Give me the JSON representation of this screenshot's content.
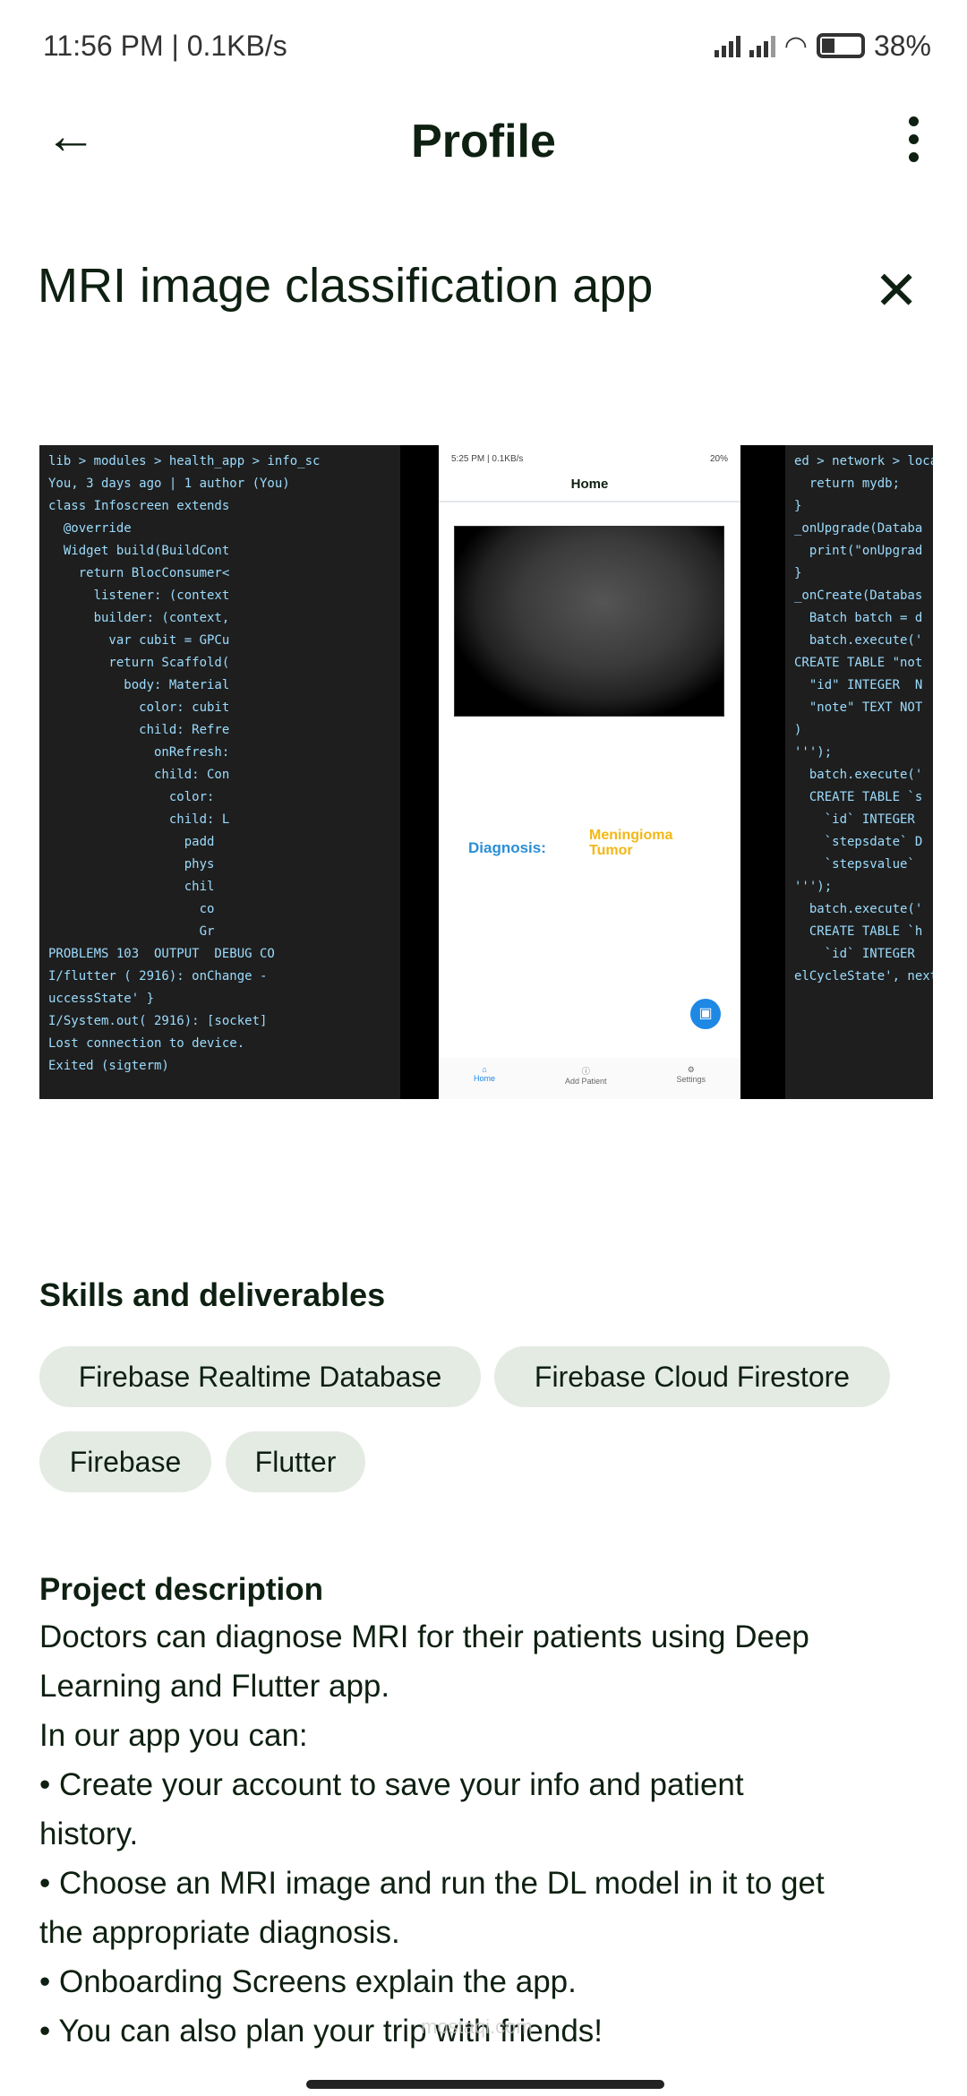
{
  "status_bar": {
    "time": "11:56 PM | 0.1KB/s",
    "battery": "38%"
  },
  "app_bar": {
    "title": "Profile"
  },
  "project": {
    "title": "MRI image classification app"
  },
  "gallery": {
    "left_code": [
      "lib > modules > health_app > info_sc",
      "You, 3 days ago | 1 author (You)",
      "class Infoscreen extends",
      "  @override",
      "  Widget build(BuildCont",
      "    return BlocConsumer<",
      "      listener: (context",
      "      builder: (context,",
      "        var cubit = GPCu",
      "        return Scaffold(",
      "          body: Material",
      "            color: cubit",
      "            child: Refre",
      "              onRefresh:",
      "              child: Con",
      "                color:",
      "                child: L",
      "                  padd",
      "                  phys",
      "                  chil",
      "                    co",
      "                    Gr",
      "",
      "",
      "PROBLEMS 103  OUTPUT  DEBUG CO",
      "I/flutter ( 2916): onChange -",
      "uccessState' }",
      "I/System.out( 2916): [socket]",
      "Lost connection to device.",
      "Exited (sigterm)"
    ],
    "phone": {
      "status": "5:25 PM | 0.1KB/s",
      "status_right": "20%",
      "title": "Home",
      "diagnosis_label": "Diagnosis:",
      "diagnosis_value": "Meningioma Tumor",
      "nav": [
        "Home",
        "Add Patient",
        "Settings"
      ]
    },
    "right_code": [
      "ed > network > local >",
      "  return mydb;",
      "}",
      "",
      "_onUpgrade(Databa",
      "  print(\"onUpgrad",
      "}",
      "",
      "_onCreate(Databas",
      "  Batch batch = d",
      "",
      "  batch.execute('",
      "CREATE TABLE \"not",
      "  \"id\" INTEGER  N",
      "  \"note\" TEXT NOT",
      ")",
      "''');",
      "  batch.execute('",
      "  CREATE TABLE `s",
      "    `id` INTEGER",
      "    `stepsdate` D",
      "    `stepsvalue`",
      "''');",
      "  batch.execute('",
      "  CREATE TABLE `h",
      "    `id` INTEGER",
      "",
      "elCycleState', next"
    ]
  },
  "skills": {
    "heading": "Skills and deliverables",
    "items": [
      "Firebase Realtime Database",
      "Firebase Cloud Firestore",
      "Firebase",
      "Flutter"
    ]
  },
  "description": {
    "heading": "Project description",
    "lines": [
      "Doctors can diagnose MRI for their patients using Deep",
      "Learning and Flutter app.",
      "In our app you can:",
      "• Create your account to save your info and patient",
      "history.",
      "• Choose an MRI image and run the DL model in it to get",
      "the appropriate diagnosis.",
      "• Onboarding Screens explain the app.",
      "• You can also plan your trip with friends!"
    ]
  },
  "watermark": "mostaqi.com"
}
